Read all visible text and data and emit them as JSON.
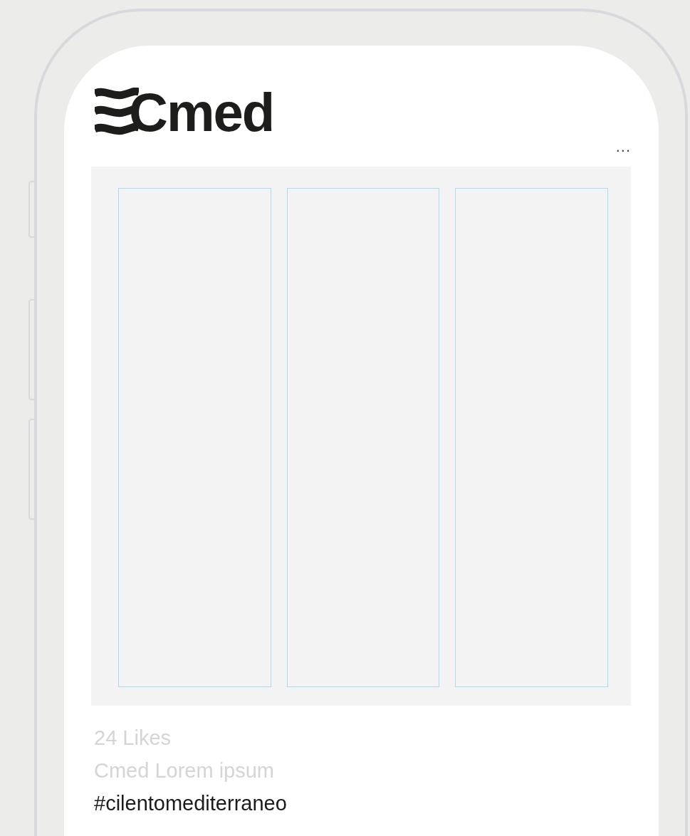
{
  "header": {
    "logo": "Cmed",
    "menu": "..."
  },
  "post": {
    "likes": "24 Likes",
    "caption": "Cmed Lorem ipsum",
    "hashtag": "#cilentomediterraneo"
  }
}
